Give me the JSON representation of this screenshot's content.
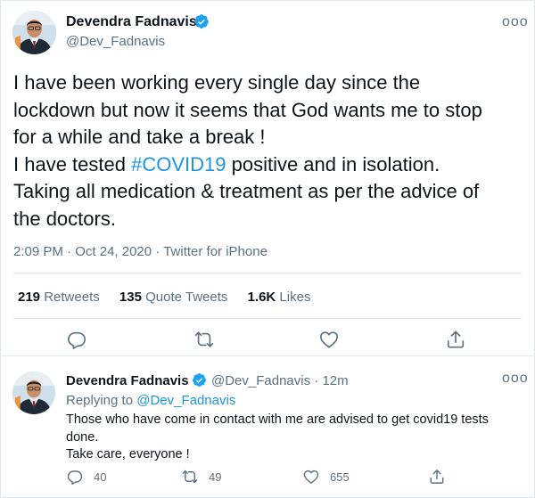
{
  "main_tweet": {
    "author_name": "Devendra Fadnavis",
    "handle": "@Dev_Fadnavis",
    "text_lines": [
      "I have been working every single day since the",
      "lockdown but now it seems that God wants me to stop",
      "for a while and take a break !",
      "I have tested ",
      "#COVID19",
      " positive and in isolation.",
      "Taking all medication & treatment as per the advice of",
      "the doctors."
    ],
    "time": "2:09 PM",
    "sep1": "·",
    "date": "Oct 24, 2020",
    "sep2": "·",
    "source": "Twitter for iPhone",
    "stats": {
      "retweets_count": "219",
      "retweets_label": "Retweets",
      "quotes_count": "135",
      "quotes_label": "Quote Tweets",
      "likes_count": "1.6K",
      "likes_label": "Likes"
    },
    "more": "ooo"
  },
  "reply_tweet": {
    "author_name": "Devendra Fadnavis",
    "handle_time": "@Dev_Fadnavis · 12m",
    "replying_prefix": "Replying to",
    "replying_to": "@Dev_Fadnavis",
    "text_lines": [
      "Those who have come in contact with me are advised to get covid19 tests",
      "done.",
      "Take care, everyone !"
    ],
    "reply_count": "40",
    "retweet_count": "49",
    "like_count": "655",
    "more": "ooo"
  },
  "colors": {
    "accent": "#1b95e0",
    "verified": "#1da1f2",
    "muted": "#5b7083",
    "text": "#0f1419",
    "border": "#e1e8ed"
  },
  "icons": {
    "reply": "reply-icon",
    "retweet": "retweet-icon",
    "like": "heart-icon",
    "share": "share-icon",
    "verified": "verified-badge-icon"
  }
}
